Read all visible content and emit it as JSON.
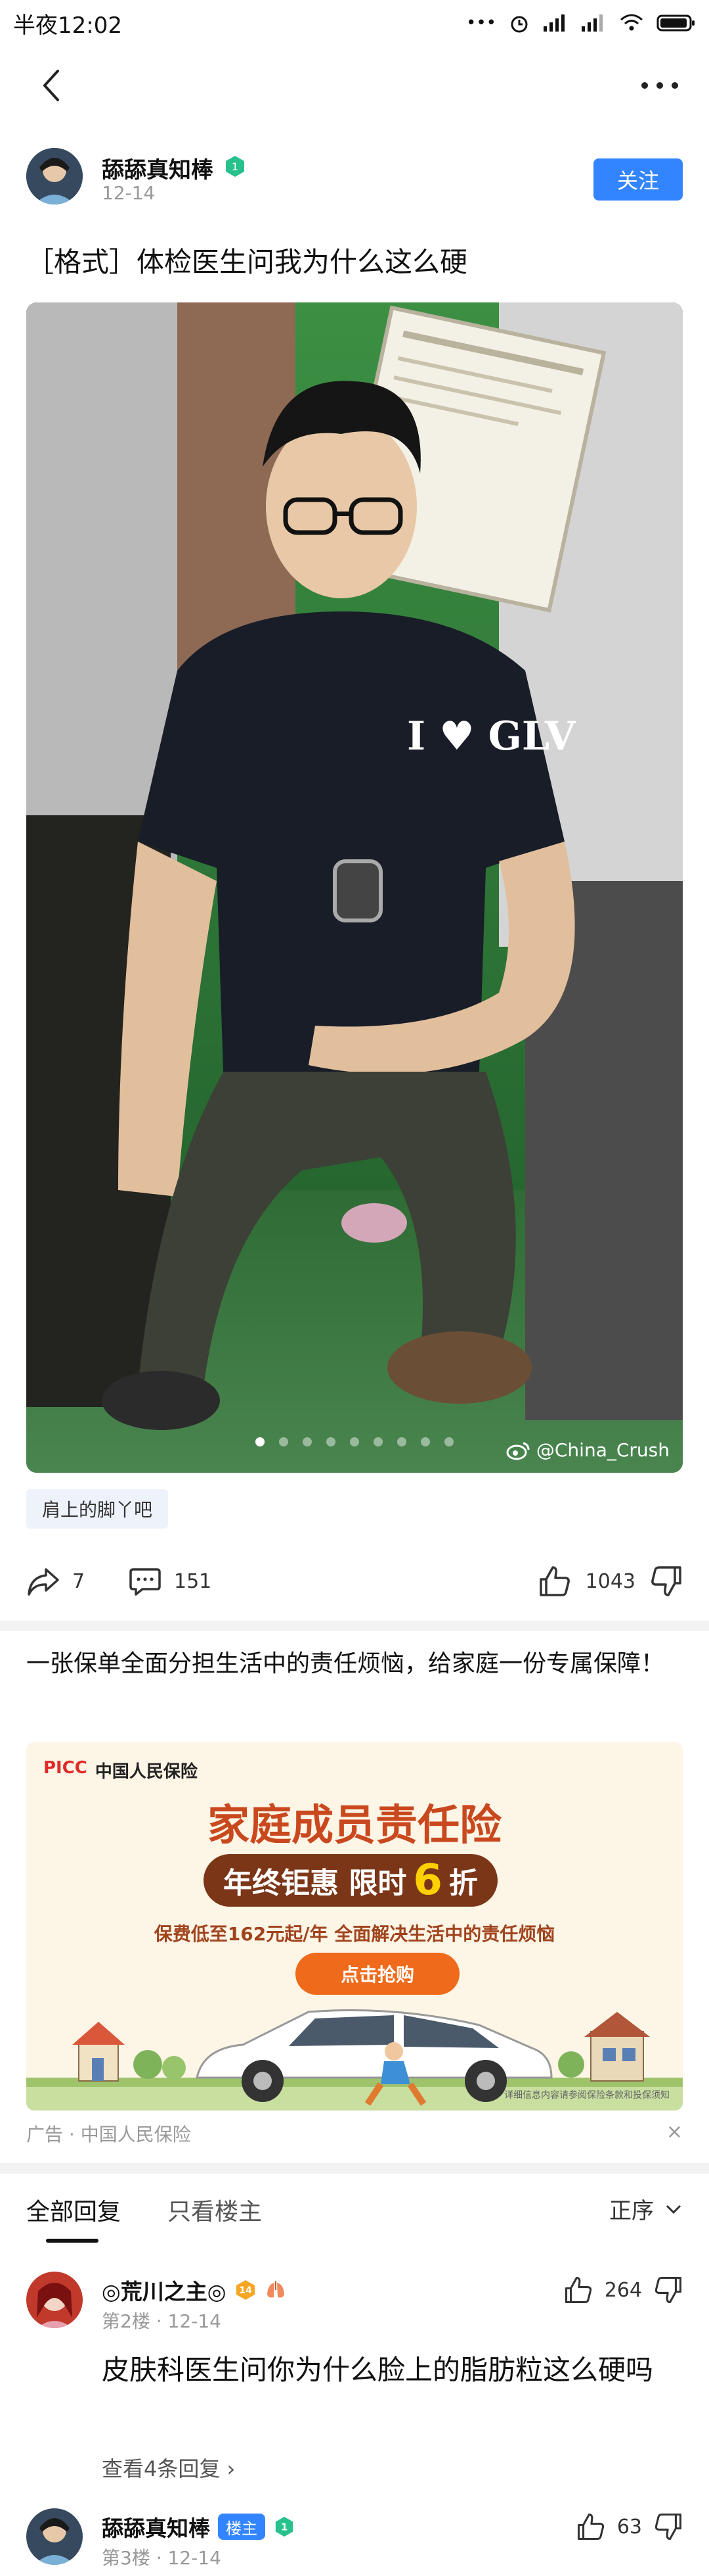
{
  "status": {
    "time": "半夜12:02",
    "dots": "•••"
  },
  "post": {
    "author": "舔舔真知棒",
    "date": "12-14",
    "follow": "关注",
    "title": "［格式］体检医生问我为什么这么硬",
    "watermark": "@China_Crush",
    "image_text": "I ♥ GLV",
    "tag": "肩上的脚丫吧",
    "shares": "7",
    "comments": "151",
    "likes": "1043",
    "colors": {
      "accent": "#3385ff"
    }
  },
  "ad": {
    "text": "一张保单全面分担生活中的责任烦恼，给家庭一份专属保障！",
    "logo_pkc": "PICC",
    "logo_cn": "中国人民保险",
    "headline": "家庭成员责任险",
    "promo_pre": "年终钜惠  限时",
    "promo_num": "6",
    "promo_post": "折",
    "sub": "保费低至162元起/年  全面解决生活中的责任烦恼",
    "cta": "点击抢购",
    "fine": "详细信息内容请参阅保险条款和投保须知",
    "source": "广告 · 中国人民保险",
    "close": "×"
  },
  "tabs": {
    "all": "全部回复",
    "op": "只看楼主",
    "sort": "正序"
  },
  "comments": [
    {
      "name": "◎荒川之主◎",
      "badge": "",
      "meta": "第2楼 · 12-14",
      "likes": "264",
      "body": "皮肤科医生问你为什么脸上的脂肪粒这么硬吗",
      "replies": "查看4条回复 ›"
    },
    {
      "name": "舔舔真知棒",
      "badge": "楼主",
      "meta": "第3楼 · 12-14",
      "likes": "63",
      "body": "",
      "replies": ""
    }
  ]
}
